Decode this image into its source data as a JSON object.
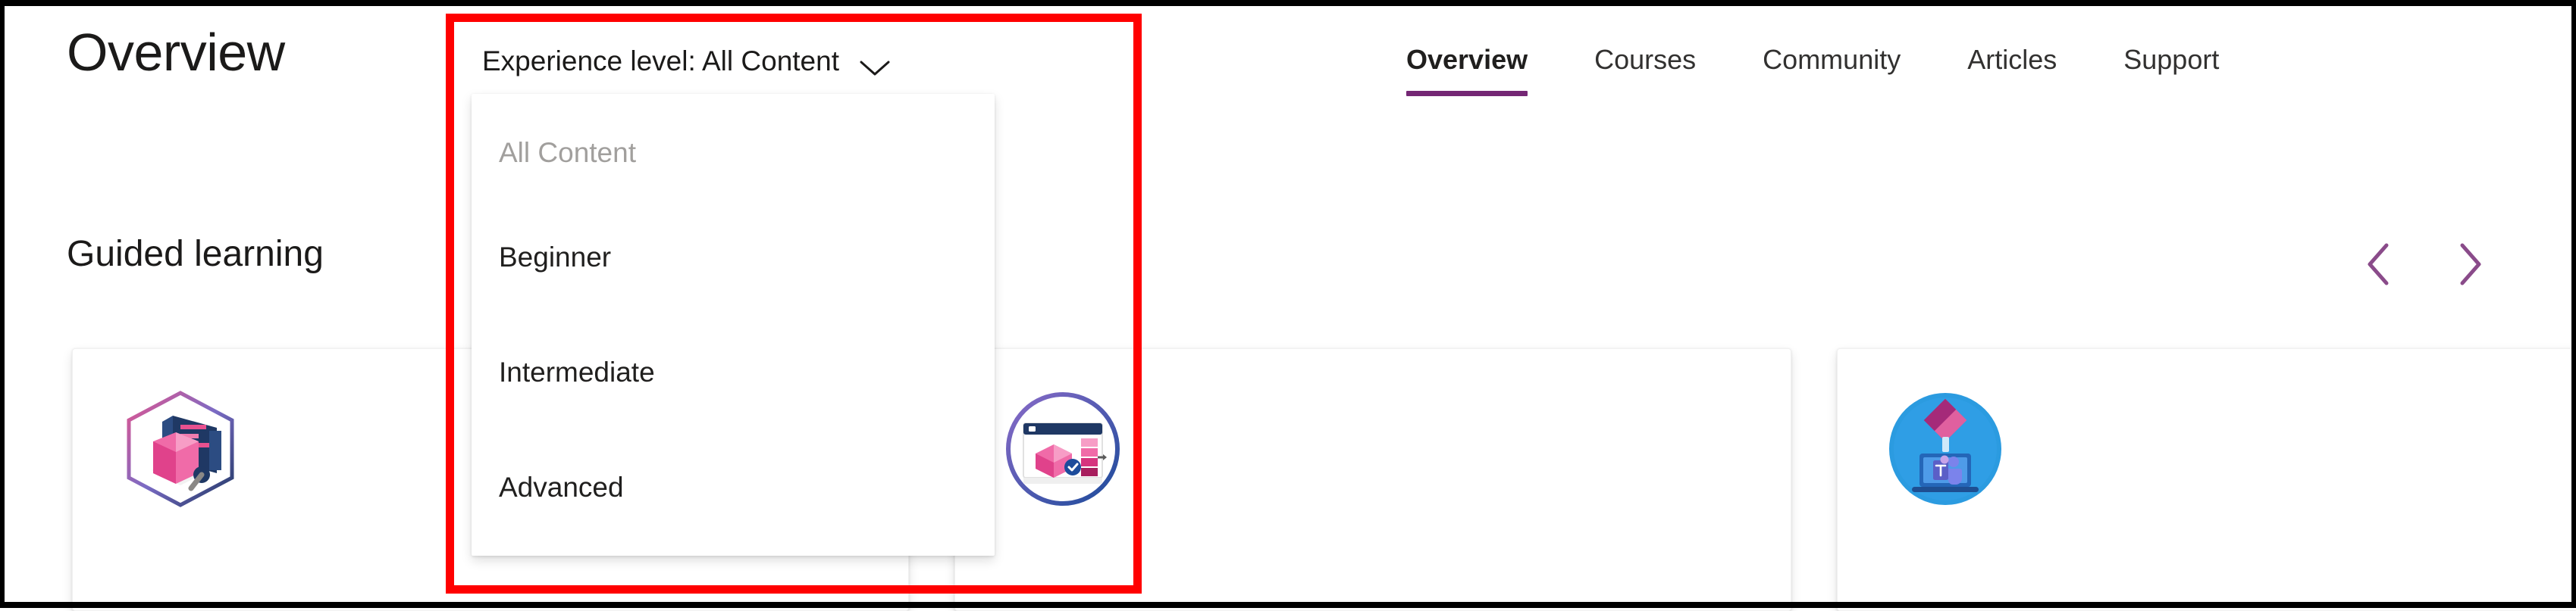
{
  "page": {
    "title": "Overview",
    "section_heading": "Guided learning"
  },
  "top_nav": {
    "items": [
      {
        "label": "Overview",
        "active": true
      },
      {
        "label": "Courses",
        "active": false
      },
      {
        "label": "Community",
        "active": false
      },
      {
        "label": "Articles",
        "active": false
      },
      {
        "label": "Support",
        "active": false
      }
    ],
    "active_underline_color": "#742774"
  },
  "filter": {
    "button_label": "Experience level: All Content",
    "chevron_icon": "chevron-down-icon",
    "expanded": true,
    "options": [
      {
        "label": "All Content",
        "selected": true
      },
      {
        "label": "Beginner",
        "selected": false
      },
      {
        "label": "Intermediate",
        "selected": false
      },
      {
        "label": "Advanced",
        "selected": false
      }
    ]
  },
  "carousel": {
    "prev_icon": "chevron-left-icon",
    "next_icon": "chevron-right-icon",
    "arrow_color": "#8A4B8A"
  },
  "cards": [
    {
      "icon_name": "hexagon-dataverse-badge-icon"
    },
    {
      "icon_name": "circle-model-driven-app-badge-icon"
    },
    {
      "icon_name": "circle-power-apps-teams-badge-icon"
    }
  ],
  "annotation": {
    "highlight_color": "#ff0000",
    "target": "experience-level-filter-dropdown"
  }
}
